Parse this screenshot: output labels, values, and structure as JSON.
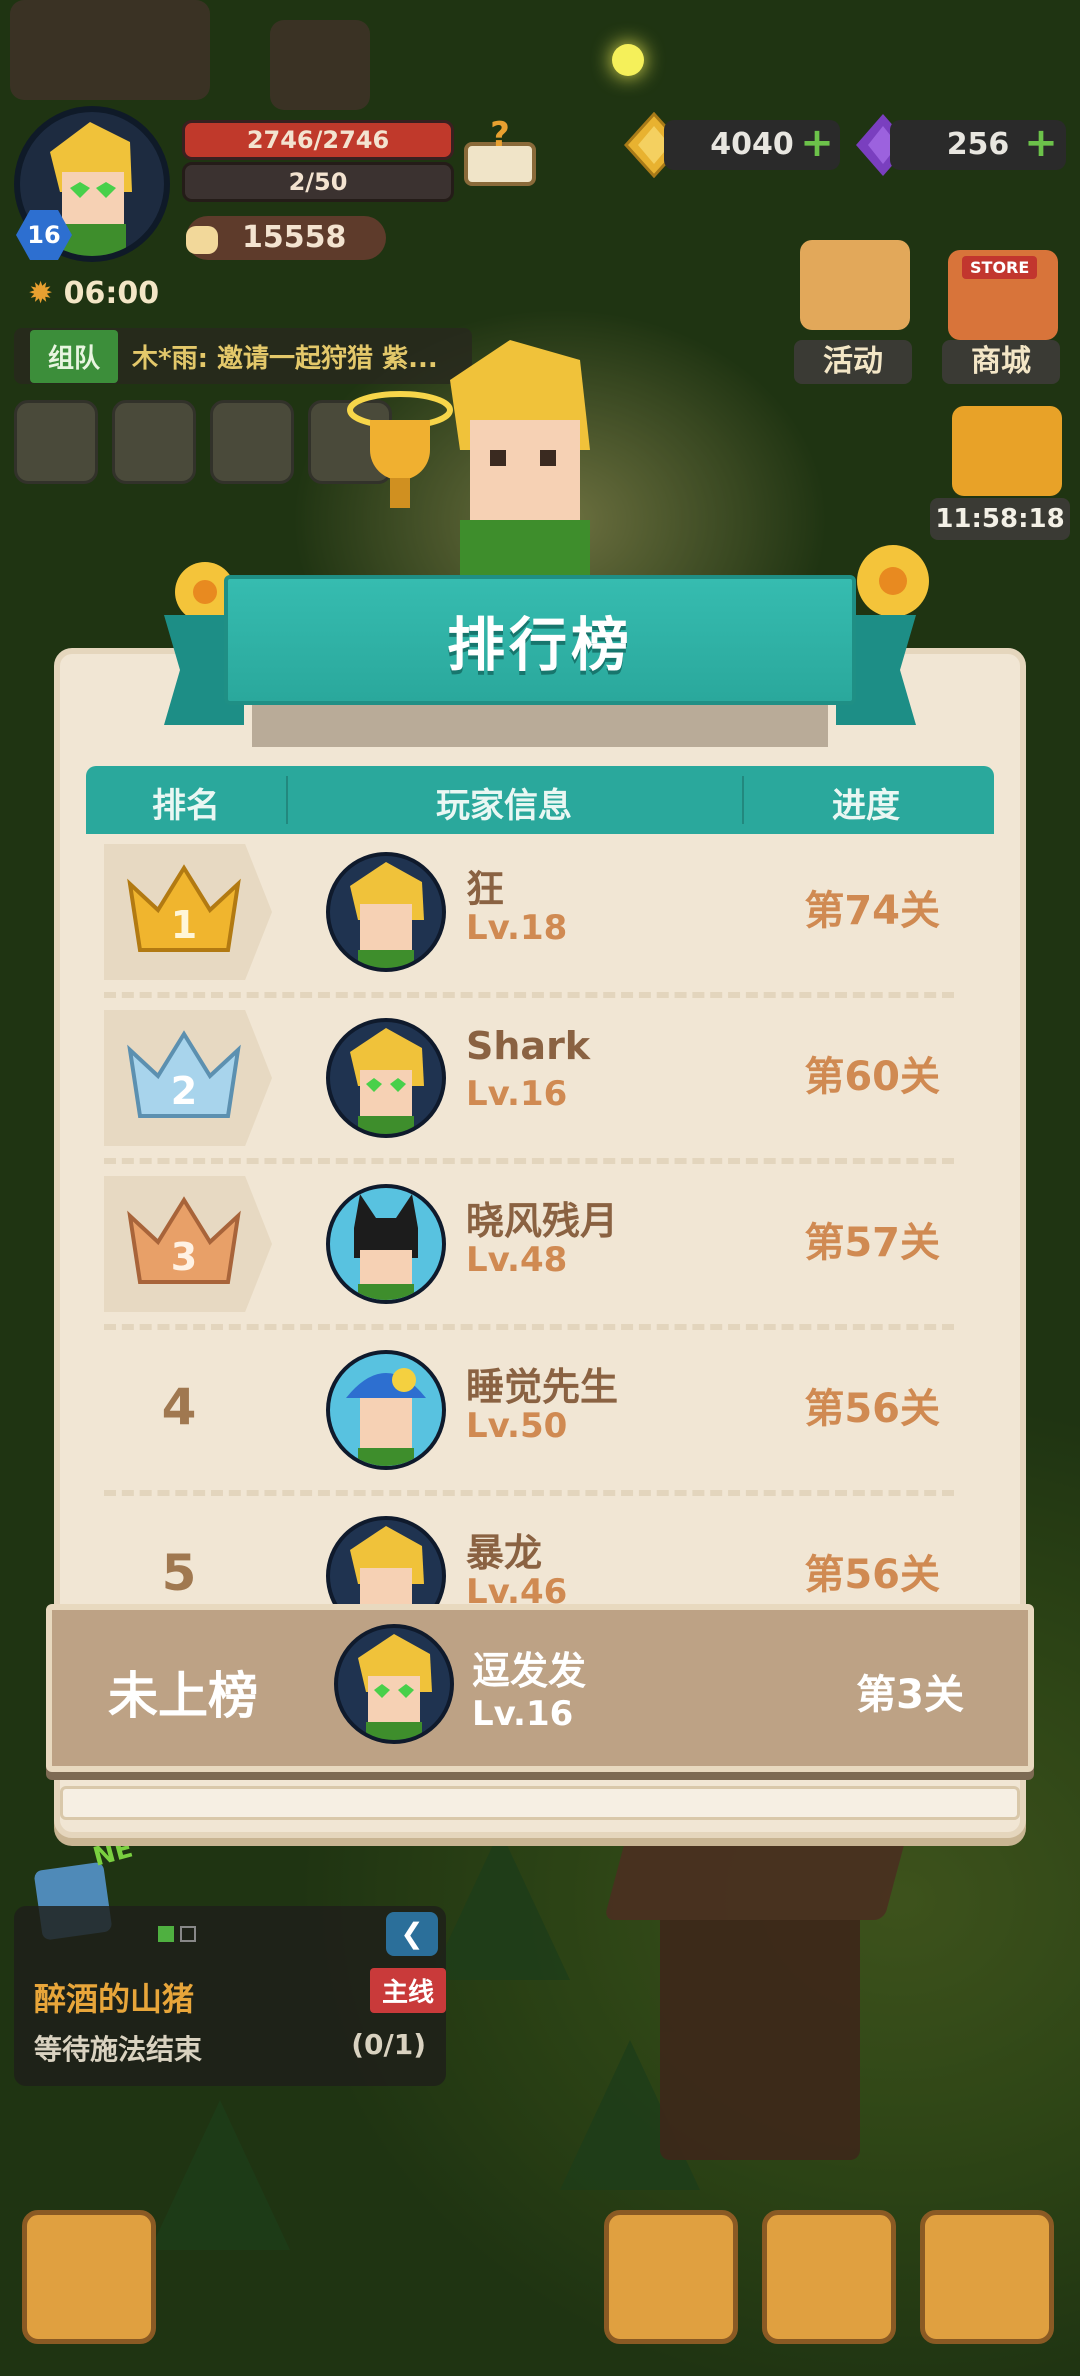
{
  "hud": {
    "hp": "2746/2746",
    "energy": "2/50",
    "power": "15558",
    "level": "16",
    "timer": "06:00",
    "gold": "4040",
    "gems": "256",
    "team_tag": "组队",
    "team_msg": "木*雨: 邀请一起狩猎 紫...",
    "activity_label": "活动",
    "store_label": "商城",
    "store_sign": "STORE",
    "gift_timer": "11:58:18",
    "colors": {
      "accent": "#2aa89c",
      "hp": "#c0392b",
      "gold": "#e8b230",
      "gem": "#7a3fbf"
    }
  },
  "quest": {
    "title": "醉酒的山猪",
    "tag": "主线",
    "desc": "等待施法结束",
    "count": "(0/1)",
    "new_badge": "NEW"
  },
  "leaderboard": {
    "title": "排行榜",
    "columns": {
      "rank": "排名",
      "player": "玩家信息",
      "progress": "进度"
    },
    "rows": [
      {
        "rank": "1",
        "name": "狂",
        "level": "Lv.18",
        "progress": "第74关"
      },
      {
        "rank": "2",
        "name": "Shark",
        "level": "Lv.16",
        "progress": "第60关"
      },
      {
        "rank": "3",
        "name": "晓风残月",
        "level": "Lv.48",
        "progress": "第57关"
      },
      {
        "rank": "4",
        "name": "睡觉先生",
        "level": "Lv.50",
        "progress": "第56关"
      },
      {
        "rank": "5",
        "name": "暴龙",
        "level": "Lv.46",
        "progress": "第56关"
      }
    ],
    "me": {
      "status": "未上榜",
      "name": "逗发发",
      "level": "Lv.16",
      "progress": "第3关"
    }
  }
}
